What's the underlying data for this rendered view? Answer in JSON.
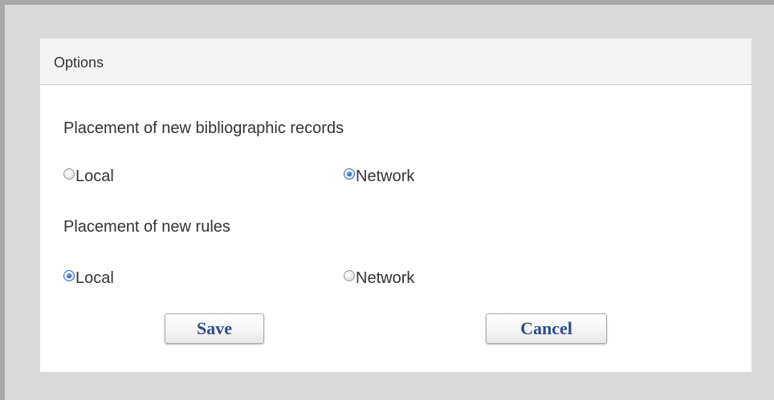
{
  "dialog": {
    "title": "Options"
  },
  "bib_records": {
    "label": "Placement of new bibliographic records",
    "options": [
      {
        "label": "Local",
        "checked": false
      },
      {
        "label": "Network",
        "checked": true
      }
    ]
  },
  "rules": {
    "label": "Placement of new rules",
    "options": [
      {
        "label": "Local",
        "checked": true
      },
      {
        "label": "Network",
        "checked": false
      }
    ]
  },
  "buttons": {
    "save_label": "Save",
    "cancel_label": "Cancel"
  },
  "colors": {
    "frame_background": "#d9d9d9",
    "frame_border": "#a8a8a8",
    "header_background": "#f3f3f3",
    "button_text": "#2c4d8b",
    "radio_checked": "#1f5fbe"
  },
  "icons": {
    "radio_selected": "radio-selected-icon",
    "radio_unselected": "radio-unselected-icon"
  }
}
